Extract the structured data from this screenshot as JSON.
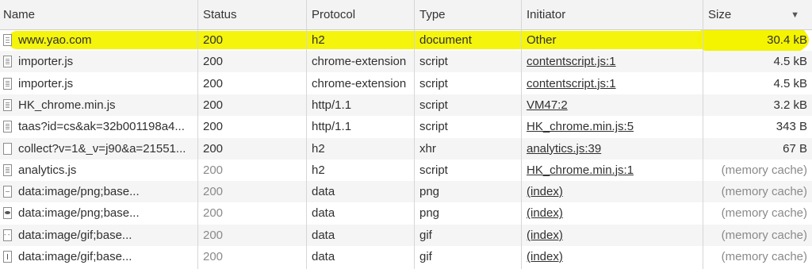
{
  "columns": {
    "name": "Name",
    "status": "Status",
    "protocol": "Protocol",
    "type": "Type",
    "initiator": "Initiator",
    "size": "Size"
  },
  "sort_indicator": "▼",
  "highlight_color": "#f3f300",
  "rows": [
    {
      "name": "www.yao.com",
      "status": "200",
      "protocol": "h2",
      "type": "document",
      "initiator": "Other",
      "size": "30.4 kB",
      "icon": "document-icon"
    },
    {
      "name": "importer.js",
      "status": "200",
      "protocol": "chrome-extension",
      "type": "script",
      "initiator": "contentscript.js:1",
      "size": "4.5 kB",
      "icon": "script-file-icon"
    },
    {
      "name": "importer.js",
      "status": "200",
      "protocol": "chrome-extension",
      "type": "script",
      "initiator": "contentscript.js:1",
      "size": "4.5 kB",
      "icon": "script-file-icon"
    },
    {
      "name": "HK_chrome.min.js",
      "status": "200",
      "protocol": "http/1.1",
      "type": "script",
      "initiator": "VM47:2",
      "size": "3.2 kB",
      "icon": "script-file-icon"
    },
    {
      "name": "taas?id=cs&ak=32b001198a4...",
      "status": "200",
      "protocol": "http/1.1",
      "type": "script",
      "initiator": "HK_chrome.min.js:5",
      "size": "343 B",
      "icon": "script-file-icon"
    },
    {
      "name": "collect?v=1&_v=j90&a=21551...",
      "status": "200",
      "protocol": "h2",
      "type": "xhr",
      "initiator": "analytics.js:39",
      "size": "67 B",
      "icon": "blank-file-icon"
    },
    {
      "name": "analytics.js",
      "status": "200",
      "protocol": "h2",
      "type": "script",
      "initiator": "HK_chrome.min.js:1",
      "size": "(memory cache)",
      "icon": "script-file-icon"
    },
    {
      "name": "data:image/png;base...",
      "status": "200",
      "protocol": "data",
      "type": "png",
      "initiator": "(index)",
      "size": "(memory cache)",
      "icon": "image-file-icon"
    },
    {
      "name": "data:image/png;base...",
      "status": "200",
      "protocol": "data",
      "type": "png",
      "initiator": "(index)",
      "size": "(memory cache)",
      "icon": "image-thumbnail-icon"
    },
    {
      "name": "data:image/gif;base...",
      "status": "200",
      "protocol": "data",
      "type": "gif",
      "initiator": "(index)",
      "size": "(memory cache)",
      "icon": "gif-file-icon"
    },
    {
      "name": "data:image/gif;base...",
      "status": "200",
      "protocol": "data",
      "type": "gif",
      "initiator": "(index)",
      "size": "(memory cache)",
      "icon": "gif-file-icon"
    }
  ]
}
